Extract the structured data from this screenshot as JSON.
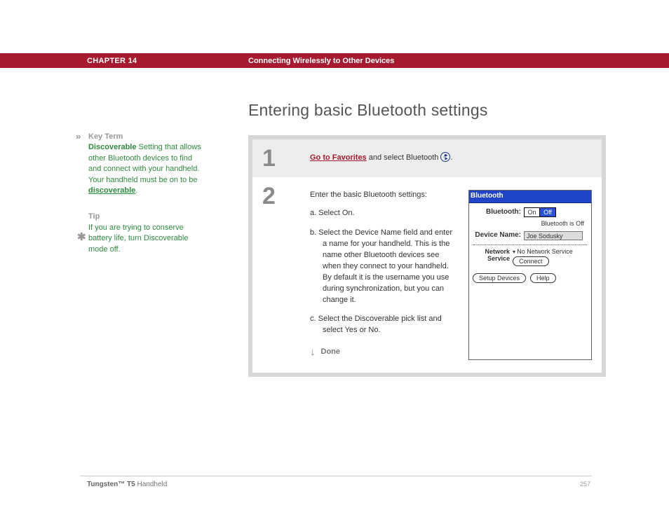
{
  "header": {
    "chapter": "CHAPTER 14",
    "chapter_title": "Connecting Wirelessly to Other Devices"
  },
  "sidebar": {
    "key_term_head": "Key Term",
    "key_term_bold": "Discoverable",
    "key_term_text": "   Setting that allows other Bluetooth devices to find and connect with your handheld. Your handheld must be on to be ",
    "key_term_link": "discoverable",
    "key_term_after": ".",
    "tip_head": "Tip",
    "tip_text": "If you are trying to conserve battery life, turn Discoverable mode off."
  },
  "main": {
    "heading": "Entering basic Bluetooth settings",
    "step1": {
      "num": "1",
      "link": "Go to Favorites",
      "after": " and select Bluetooth ",
      "period": "."
    },
    "step2": {
      "num": "2",
      "intro": "Enter the basic Bluetooth settings:",
      "a": "a.   Select On.",
      "b": "b.   Select the Device Name field and enter a name for your handheld. This is the name other Bluetooth devices see when they connect to your handheld. By default it is the username you use during synchronization, but you can change it.",
      "c": "c.   Select the Discoverable pick list and select Yes or No.",
      "done": "Done"
    }
  },
  "palm": {
    "title": "Bluetooth",
    "row_bluetooth": "Bluetooth:",
    "on": "On",
    "off": "Off",
    "status": "Bluetooth is Off",
    "row_device": "Device Name:",
    "device_value": "Joe Sodusky",
    "net_label1": "Network",
    "net_label2": "Service",
    "net_value": "No Network Service",
    "connect": "Connect",
    "setup": "Setup Devices",
    "help": "Help"
  },
  "footer": {
    "product_bold": "Tungsten™ T5",
    "product_rest": " Handheld",
    "page": "257"
  }
}
